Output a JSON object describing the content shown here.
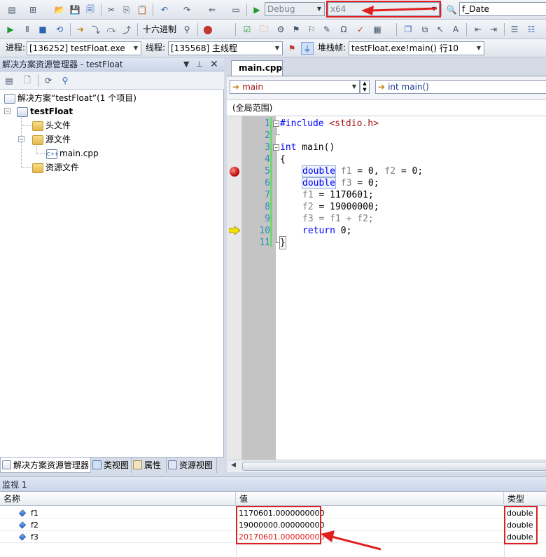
{
  "toolbar1": {
    "config_value": "Debug",
    "platform_value": "x64",
    "find_value": "f_Date"
  },
  "toolbar2": {
    "hex_label": "十六进制"
  },
  "toolbar3": {
    "process_label": "进程:",
    "process_value": "[136252] testFloat.exe",
    "thread_label": "线程:",
    "thread_value": "[135568] 主线程",
    "stackframe_label": "堆栈帧:",
    "stackframe_value": "testFloat.exe!main()  行10"
  },
  "solution_explorer": {
    "title": "解决方案资源管理器 - testFloat",
    "solution_label": "解决方案“testFloat”(1 个项目)",
    "project_label": "testFloat",
    "folders": {
      "headers": "头文件",
      "sources": "源文件",
      "source_file": "main.cpp",
      "resources": "资源文件"
    },
    "tabs": [
      "解决方案资源管理器",
      "类视图",
      "属性",
      "资源视图"
    ]
  },
  "editor": {
    "tab": "main.cpp",
    "nav_left": "main",
    "nav_right": "int main()",
    "scope": "(全局范围)",
    "line_numbers": [
      "1",
      "2",
      "3",
      "4",
      "5",
      "6",
      "7",
      "8",
      "9",
      "10",
      "11"
    ],
    "lines": {
      "l1_directive": "#include",
      "l1_header": " <stdio.h>",
      "l3_kw": "int",
      "l3_rest": " main()",
      "l4": "{",
      "l5_kw": "double",
      "l5_a": " f1",
      "l5_b": " = 0, ",
      "l5_c": "f2",
      "l5_d": " = 0;",
      "l6_kw": "double",
      "l6_a": " f3",
      "l6_b": " = 0;",
      "l7_a": "f1",
      "l7_b": " = 1170601;",
      "l8_a": "f2",
      "l8_b": " = 19000000;",
      "l9_a": "f3 = f1 + f2;",
      "l10_kw": "return",
      "l10_b": " 0;",
      "l11": "}"
    },
    "fold_minus": "−"
  },
  "watch": {
    "title": "监视 1",
    "columns": {
      "name": "名称",
      "value": "值",
      "type": "类型"
    },
    "rows": [
      {
        "name": "f1",
        "value": "1170601.0000000000",
        "type": "double"
      },
      {
        "name": "f2",
        "value": "19000000.000000000",
        "type": "double"
      },
      {
        "name": "f3",
        "value": "20170601.000000000",
        "type": "double"
      }
    ]
  },
  "colors": {
    "annotation_red": "#e02020",
    "changed_value_red": "#e02020",
    "keyword_blue": "#0000ff"
  }
}
